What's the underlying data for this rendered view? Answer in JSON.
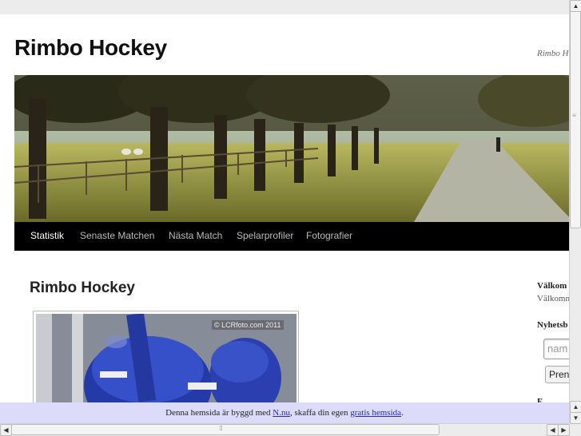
{
  "site": {
    "title": "Rimbo Hockey",
    "description": "Rimbo H"
  },
  "nav": {
    "items": [
      {
        "label": "Statistik",
        "active": true
      },
      {
        "label": "Senaste Matchen"
      },
      {
        "label": "Nästa Match"
      },
      {
        "label": "Spelarprofiler"
      },
      {
        "label": "Fotografier"
      }
    ]
  },
  "post": {
    "title": "Rimbo Hockey",
    "image_watermark": "© LCRfoto.com 2011"
  },
  "sidebar": {
    "welcome_heading": "Välkom",
    "welcome_text": "Välkomn",
    "newsletter_heading": "Nyhetsb",
    "input_placeholder": "nam",
    "button_label": "Pren",
    "cut_heading": "F"
  },
  "footer": {
    "text_prefix": "Denna hemsida är byggd med ",
    "link1": "N.nu",
    "text_middle": ", skaffa din egen ",
    "link2": "gratis hemsida",
    "text_suffix": "."
  },
  "colors": {
    "nav_bg": "#000000",
    "footer_bg": "#dcdcfa",
    "link": "#2a2aaa"
  }
}
